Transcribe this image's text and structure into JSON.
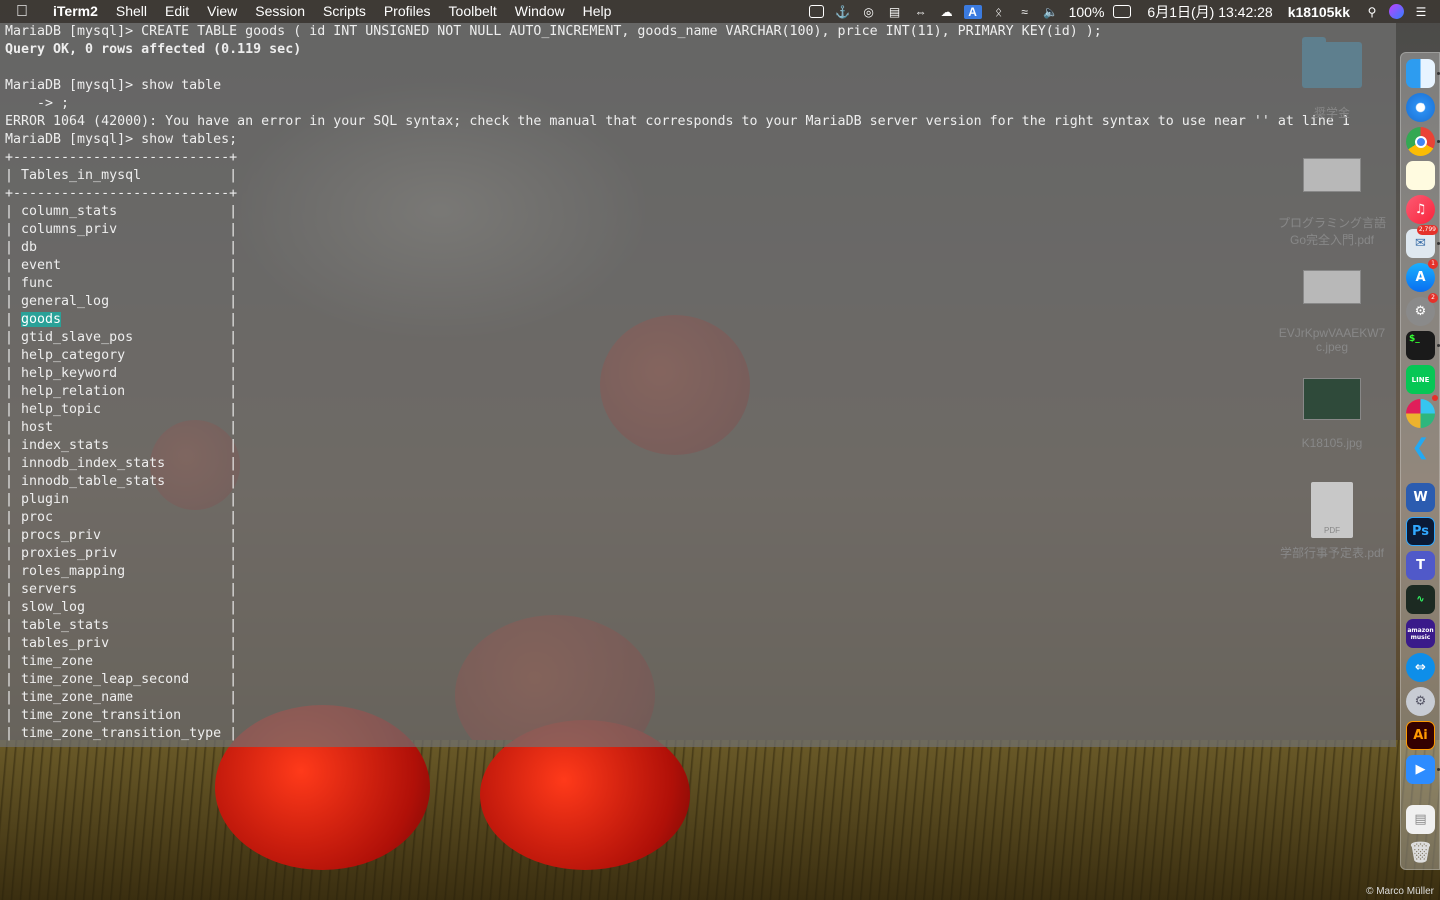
{
  "menubar": {
    "app_name": "iTerm2",
    "menus": [
      "Shell",
      "Edit",
      "View",
      "Session",
      "Scripts",
      "Profiles",
      "Toolbelt",
      "Window",
      "Help"
    ],
    "battery": "100%",
    "datetime": "6月1日(月)  13:42:28",
    "user": "k18105kk"
  },
  "terminal": {
    "lines": [
      "MariaDB [mysql]> CREATE TABLE goods ( id INT UNSIGNED NOT NULL AUTO_INCREMENT, goods_name VARCHAR(100), price INT(11), PRIMARY KEY(id) );",
      "Query OK, 0 rows affected (0.119 sec)",
      "",
      "MariaDB [mysql]> show table",
      "    -> ;",
      "ERROR 1064 (42000): You have an error in your SQL syntax; check the manual that corresponds to your MariaDB server version for the right syntax to use near '' at line 1",
      "MariaDB [mysql]> show tables;",
      "+---------------------------+",
      "| Tables_in_mysql           |",
      "+---------------------------+",
      "| column_stats              |",
      "| columns_priv              |",
      "| db                        |",
      "| event                     |",
      "| func                      |",
      "| general_log               |",
      "| goods                     |",
      "| gtid_slave_pos            |",
      "| help_category             |",
      "| help_keyword              |",
      "| help_relation             |",
      "| help_topic                |",
      "| host                      |",
      "| index_stats               |",
      "| innodb_index_stats        |",
      "| innodb_table_stats        |",
      "| plugin                    |",
      "| proc                      |",
      "| procs_priv                |",
      "| proxies_priv              |",
      "| roles_mapping             |",
      "| servers                   |",
      "| slow_log                  |",
      "| table_stats               |",
      "| tables_priv               |",
      "| time_zone                 |",
      "| time_zone_leap_second     |",
      "| time_zone_name            |",
      "| time_zone_transition      |",
      "| time_zone_transition_type |"
    ],
    "highlighted_word": "goods"
  },
  "desktop_files": [
    {
      "label_line1": "奨学金",
      "label_line2": "",
      "kind": "folder"
    },
    {
      "label_line1": "プログラミング言語",
      "label_line2": "Go完全入門.pdf",
      "kind": "image"
    },
    {
      "label_line1": "EVJrKpwVAAEKW7",
      "label_line2": "c.jpeg",
      "kind": "image"
    },
    {
      "label_line1": "K18105.jpg",
      "label_line2": "",
      "kind": "image-dark"
    },
    {
      "label_line1": "学部行事予定表.pdf",
      "label_line2": "",
      "kind": "pdf",
      "thumb_text": "PDF"
    }
  ],
  "dock": {
    "word_label": "W",
    "ps_label": "Ps",
    "teams_label": "T",
    "amazon_label": "amazon music",
    "ai_label": "Ai",
    "mail_badge": "2,799",
    "appstore_badge": "1",
    "prefs_badge": "2"
  },
  "wallpaper_credit": "© Marco Müller",
  "colors": {
    "terminal_bg": "#707070",
    "highlight": "#2aa198",
    "menubar_bg": "#3c3732"
  }
}
